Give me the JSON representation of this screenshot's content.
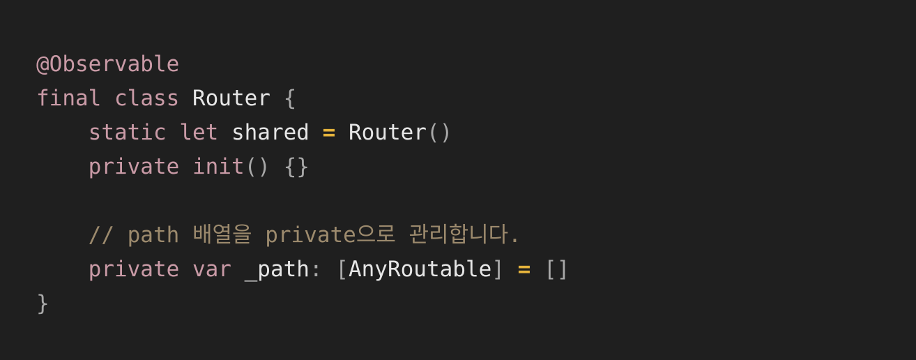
{
  "code": {
    "lines": [
      [
        {
          "text": "@Observable",
          "kind": "attr"
        }
      ],
      [
        {
          "text": "final",
          "kind": "kw"
        },
        {
          "text": " ",
          "kind": "ident"
        },
        {
          "text": "class",
          "kind": "kw"
        },
        {
          "text": " Router ",
          "kind": "type"
        },
        {
          "text": "{",
          "kind": "punc"
        }
      ],
      [
        {
          "text": "    ",
          "kind": "ident"
        },
        {
          "text": "static",
          "kind": "kw"
        },
        {
          "text": " ",
          "kind": "ident"
        },
        {
          "text": "let",
          "kind": "kw"
        },
        {
          "text": " shared ",
          "kind": "ident"
        },
        {
          "text": "=",
          "kind": "op"
        },
        {
          "text": " Router",
          "kind": "type"
        },
        {
          "text": "()",
          "kind": "punc"
        }
      ],
      [
        {
          "text": "    ",
          "kind": "ident"
        },
        {
          "text": "private",
          "kind": "kw"
        },
        {
          "text": " ",
          "kind": "ident"
        },
        {
          "text": "init",
          "kind": "kw"
        },
        {
          "text": "() {}",
          "kind": "punc"
        }
      ],
      [],
      [
        {
          "text": "    ",
          "kind": "ident"
        },
        {
          "text": "// path 배열을 private으로 관리합니다.",
          "kind": "comment"
        }
      ],
      [
        {
          "text": "    ",
          "kind": "ident"
        },
        {
          "text": "private",
          "kind": "kw"
        },
        {
          "text": " ",
          "kind": "ident"
        },
        {
          "text": "var",
          "kind": "kw"
        },
        {
          "text": " _path",
          "kind": "ident"
        },
        {
          "text": ": [",
          "kind": "punc"
        },
        {
          "text": "AnyRoutable",
          "kind": "type"
        },
        {
          "text": "] ",
          "kind": "punc"
        },
        {
          "text": "=",
          "kind": "op"
        },
        {
          "text": " []",
          "kind": "punc"
        }
      ],
      [
        {
          "text": "}",
          "kind": "punc"
        }
      ]
    ]
  },
  "colors": {
    "background": "#1f1f1f",
    "keyword": "#c99aa6",
    "identifier": "#e6e6e6",
    "punctuation": "#a8a8a8",
    "operator": "#e5b33c",
    "comment": "#9c8a6d"
  }
}
